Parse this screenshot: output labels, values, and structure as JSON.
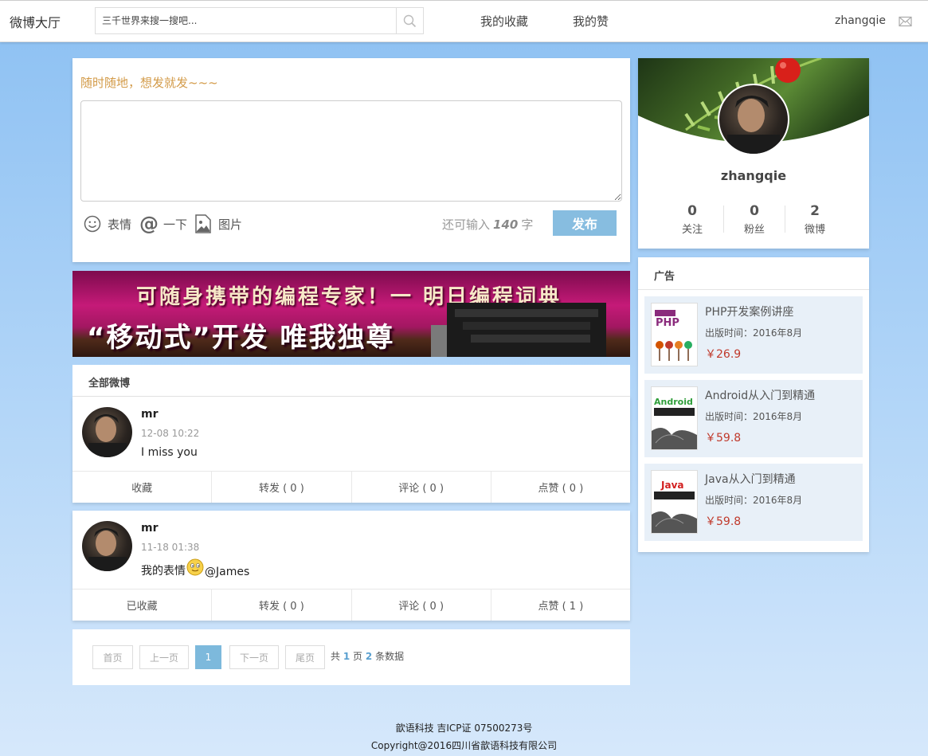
{
  "topbar": {
    "brand": "微博大厅",
    "search_placeholder": "三千世界来搜一搜吧...",
    "nav": [
      "我的收藏",
      "我的赞"
    ],
    "username": "zhangqie"
  },
  "composer": {
    "prompt": "随时随地，想发就发~~~",
    "tools": {
      "emoji": "表情",
      "mention": "一下",
      "image": "图片"
    },
    "counter_prefix": "还可输入",
    "counter_value": "140",
    "counter_suffix": "字",
    "publish": "发布"
  },
  "banner": {
    "line1": "可随身携带的编程专家！一 明日编程词典",
    "line2": "“移动式”开发 唯我独尊"
  },
  "feed": {
    "title": "全部微博",
    "posts": [
      {
        "user": "mr",
        "time": "12-08 10:22",
        "content": "I miss you",
        "actions": [
          "收藏",
          "转发 ( 0 )",
          "评论 ( 0 )",
          "点赞 ( 0 )"
        ]
      },
      {
        "user": "mr",
        "time": "11-18 01:38",
        "content_before": "我的表情",
        "content_after": "@James",
        "actions": [
          "已收藏",
          "转发 ( 0 )",
          "评论 ( 0 )",
          "点赞 ( 1 )"
        ]
      }
    ]
  },
  "pager": {
    "first": "首页",
    "prev": "上一页",
    "current": "1",
    "next": "下一页",
    "last": "尾页",
    "info_prefix": "共",
    "total_pages": "1",
    "info_mid": "页",
    "total_items": "2",
    "info_suffix": "条数据"
  },
  "profile": {
    "name": "zhangqie",
    "stats": [
      {
        "num": "0",
        "label": "关注"
      },
      {
        "num": "0",
        "label": "粉丝"
      },
      {
        "num": "2",
        "label": "微博"
      }
    ]
  },
  "ads": {
    "title": "广告",
    "items": [
      {
        "name": "PHP开发案例讲座",
        "date": "出版时间：2016年8月",
        "price": "￥26.9",
        "cover_text": "PHP"
      },
      {
        "name": "Android从入门到精通",
        "date": "出版时间：2016年8月",
        "price": "￥59.8",
        "cover_text": "Android"
      },
      {
        "name": "Java从入门到精通",
        "date": "出版时间：2016年8月",
        "price": "￥59.8",
        "cover_text": "Java"
      }
    ]
  },
  "footer": {
    "line1": "歆语科技 吉ICP证 07500273号",
    "line2": "Copyright@2016四川省歆语科技有限公司"
  }
}
